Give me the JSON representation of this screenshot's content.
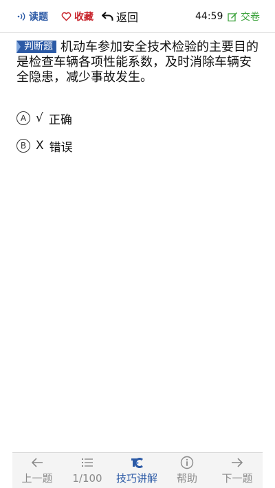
{
  "toolbar": {
    "read_label": "读题",
    "favorite_label": "收藏",
    "back_label": "返回",
    "timer": "44:59",
    "submit_label": "交卷"
  },
  "question": {
    "type_badge": "判断题",
    "text": "机动车参加安全技术检验的主要目的是检查车辆各项性能系数，及时消除车辆安全隐患，减少事故发生。"
  },
  "options": [
    {
      "letter": "A",
      "mark": "√",
      "text": "正确"
    },
    {
      "letter": "B",
      "mark": "X",
      "text": "错误"
    }
  ],
  "bottombar": {
    "prev_label": "上一题",
    "progress": "1/100",
    "tips_label": "技巧讲解",
    "help_label": "帮助",
    "next_label": "下一题"
  },
  "colors": {
    "accent_blue": "#2c5aa6",
    "favorite_red": "#c8232b",
    "submit_green": "#3aa13a",
    "inactive_gray": "#8a8a8a"
  },
  "icons": {
    "read": "speaker-waves-icon",
    "favorite": "heart-outline-icon",
    "back": "back-arrow-icon",
    "submit": "edit-square-icon",
    "prev": "arrow-left-icon",
    "list": "list-icon",
    "tips": "tips-logo-icon",
    "help": "info-circle-icon",
    "next": "arrow-right-icon"
  }
}
